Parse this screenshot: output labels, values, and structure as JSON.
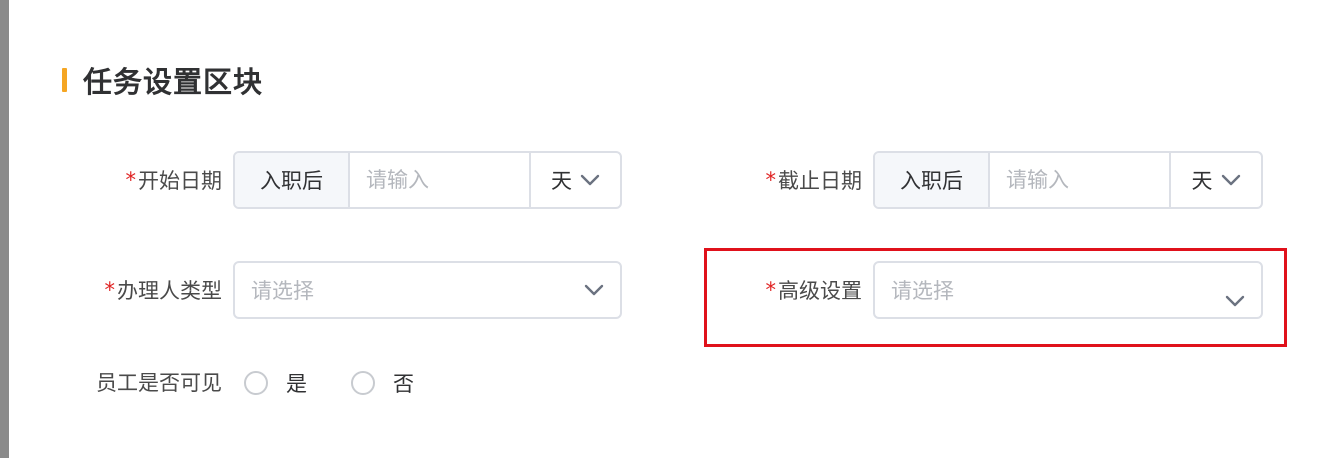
{
  "section": {
    "title": "任务设置区块",
    "accent_color": "#f5a623"
  },
  "start_date": {
    "label": "开始日期",
    "required": "*",
    "prepend": "入职后",
    "placeholder": "请输入",
    "unit": "天"
  },
  "end_date": {
    "label": "截止日期",
    "required": "*",
    "prepend": "入职后",
    "placeholder": "请输入",
    "unit": "天"
  },
  "handler_type": {
    "label": "办理人类型",
    "required": "*",
    "placeholder": "请选择"
  },
  "advanced": {
    "label": "高级设置",
    "required": "*",
    "placeholder": "请选择",
    "highlight_color": "#e0111b"
  },
  "visibility": {
    "label": "员工是否可见",
    "options": [
      {
        "label": "是"
      },
      {
        "label": "否"
      }
    ]
  },
  "icons": {
    "dropdown": "chevron-down-icon",
    "radio": "radio-circle-icon"
  }
}
